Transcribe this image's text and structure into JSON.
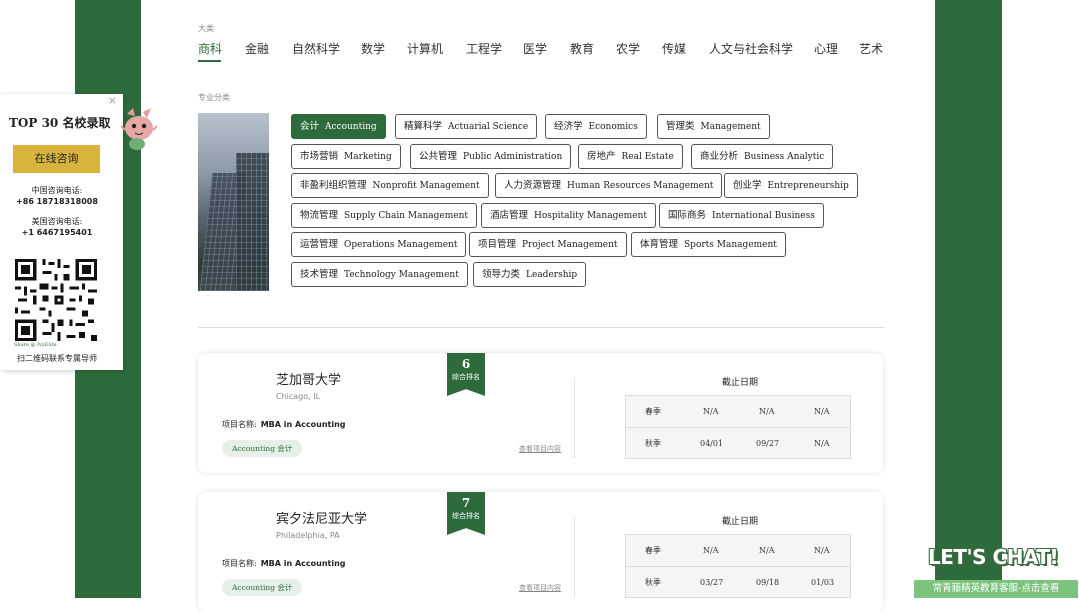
{
  "nav": {
    "category_label": "大类",
    "categories": [
      "商科",
      "金融",
      "自然科学",
      "数学",
      "计算机",
      "工程学",
      "医学",
      "教育",
      "农学",
      "传媒",
      "人文与社会科学",
      "心理",
      "艺术"
    ],
    "active": "商科"
  },
  "majors": {
    "label": "专业分类",
    "items": [
      {
        "zh": "会计",
        "en": "Accounting",
        "active": true
      },
      {
        "zh": "精算科学",
        "en": "Actuarial Science"
      },
      {
        "zh": "经济学",
        "en": "Economics"
      },
      {
        "zh": "管理类",
        "en": "Management"
      },
      {
        "zh": "市场营销",
        "en": "Marketing"
      },
      {
        "zh": "公共管理",
        "en": "Public Administration"
      },
      {
        "zh": "房地产",
        "en": "Real Estate"
      },
      {
        "zh": "商业分析",
        "en": "Business Analytic"
      },
      {
        "zh": "非盈利组织管理",
        "en": "Nonprofit Management"
      },
      {
        "zh": "人力资源管理",
        "en": "Human Resources Management"
      },
      {
        "zh": "创业学",
        "en": "Entrepreneurship"
      },
      {
        "zh": "物流管理",
        "en": "Supply Chain Management"
      },
      {
        "zh": "酒店管理",
        "en": "Hospitality Management"
      },
      {
        "zh": "国际商务",
        "en": "International Business"
      },
      {
        "zh": "运营管理",
        "en": "Operations Management"
      },
      {
        "zh": "项目管理",
        "en": "Project Management"
      },
      {
        "zh": "体育管理",
        "en": "Sports Management"
      },
      {
        "zh": "技术管理",
        "en": "Technology Management"
      },
      {
        "zh": "领导力类",
        "en": "Leadership"
      }
    ]
  },
  "cards": [
    {
      "name": "芝加哥大学",
      "location": "Chicago, IL",
      "program_label": "项目名称:",
      "program": "MBA in Accounting",
      "tag": "Accounting 会计",
      "detail_link": "查看项目内容",
      "rank": "6",
      "rank_label": "综合排名",
      "deadline_title": "截止日期",
      "rows": [
        {
          "season": "春季",
          "d1": "N/A",
          "d2": "N/A",
          "d3": "N/A"
        },
        {
          "season": "秋季",
          "d1": "04/01",
          "d2": "09/27",
          "d3": "N/A"
        }
      ]
    },
    {
      "name": "宾夕法尼亚大学",
      "location": "Philadelphia, PA",
      "program_label": "项目名称:",
      "program": "MBA in Accounting",
      "tag": "Accounting 会计",
      "detail_link": "查看项目内容",
      "rank": "7",
      "rank_label": "综合排名",
      "deadline_title": "截止日期",
      "rows": [
        {
          "season": "春季",
          "d1": "N/A",
          "d2": "N/A",
          "d3": "N/A"
        },
        {
          "season": "秋季",
          "d1": "03/27",
          "d2": "09/18",
          "d3": "01/03"
        }
      ]
    }
  ],
  "side_panel": {
    "close": "×",
    "title": "TOP 30 名校录取",
    "button": "在线咨询",
    "cn_label": "中国咨询电话:",
    "cn_phone": "+86 18718318008",
    "us_label": "美国咨询电话:",
    "us_phone": "+1 6467195401",
    "qr_caption": "Share @ IvyElite",
    "footer": "扫二维码联系专属导师"
  },
  "chat": {
    "headline": "LET'S CHAT!",
    "bar": "常青藤精英教育客服-点击查看"
  },
  "colors": {
    "brand_green": "#2d6b3c",
    "gold": "#d9b43c",
    "chat_green": "#7cc47e"
  }
}
